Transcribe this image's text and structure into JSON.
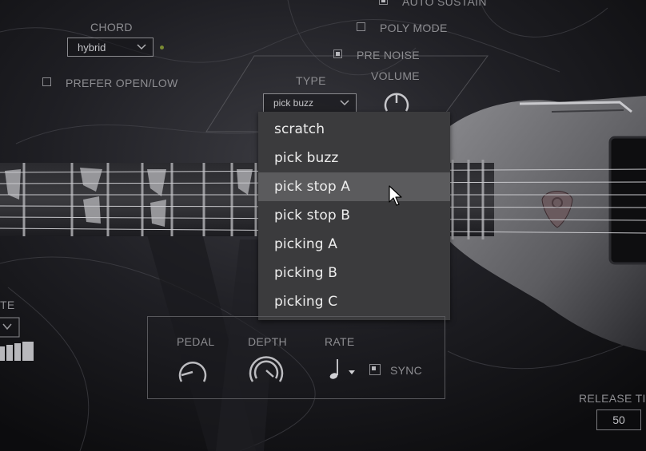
{
  "chord": {
    "label": "CHORD",
    "value": "hybrid"
  },
  "prefer_open_low": {
    "label": "PREFER OPEN/LOW",
    "checked": false
  },
  "auto_sustain": {
    "label": "AUTO SUSTAIN",
    "checked": true
  },
  "poly_mode": {
    "label": "POLY MODE",
    "checked": false
  },
  "pre_noise": {
    "label": "PRE NOISE",
    "checked": true
  },
  "type": {
    "label": "TYPE",
    "value": "pick buzz",
    "options": [
      "scratch",
      "pick buzz",
      "pick stop A",
      "pick stop B",
      "picking A",
      "picking B",
      "picking C"
    ],
    "hovered": "pick stop A"
  },
  "volume": {
    "label": "VOLUME"
  },
  "lfo": {
    "pedal_label": "PEDAL",
    "depth_label": "DEPTH",
    "rate_label": "RATE",
    "sync_label": "SYNC",
    "sync_checked": true,
    "rate_note_icon": "quarter-note-icon"
  },
  "release": {
    "label": "RELEASE TI",
    "value": "50"
  },
  "left_cut_label": "TE",
  "colors": {
    "menu_bg": "#3b3b3d",
    "menu_hover": "#5b5b5d",
    "accent_dot": "#7b8a33"
  }
}
